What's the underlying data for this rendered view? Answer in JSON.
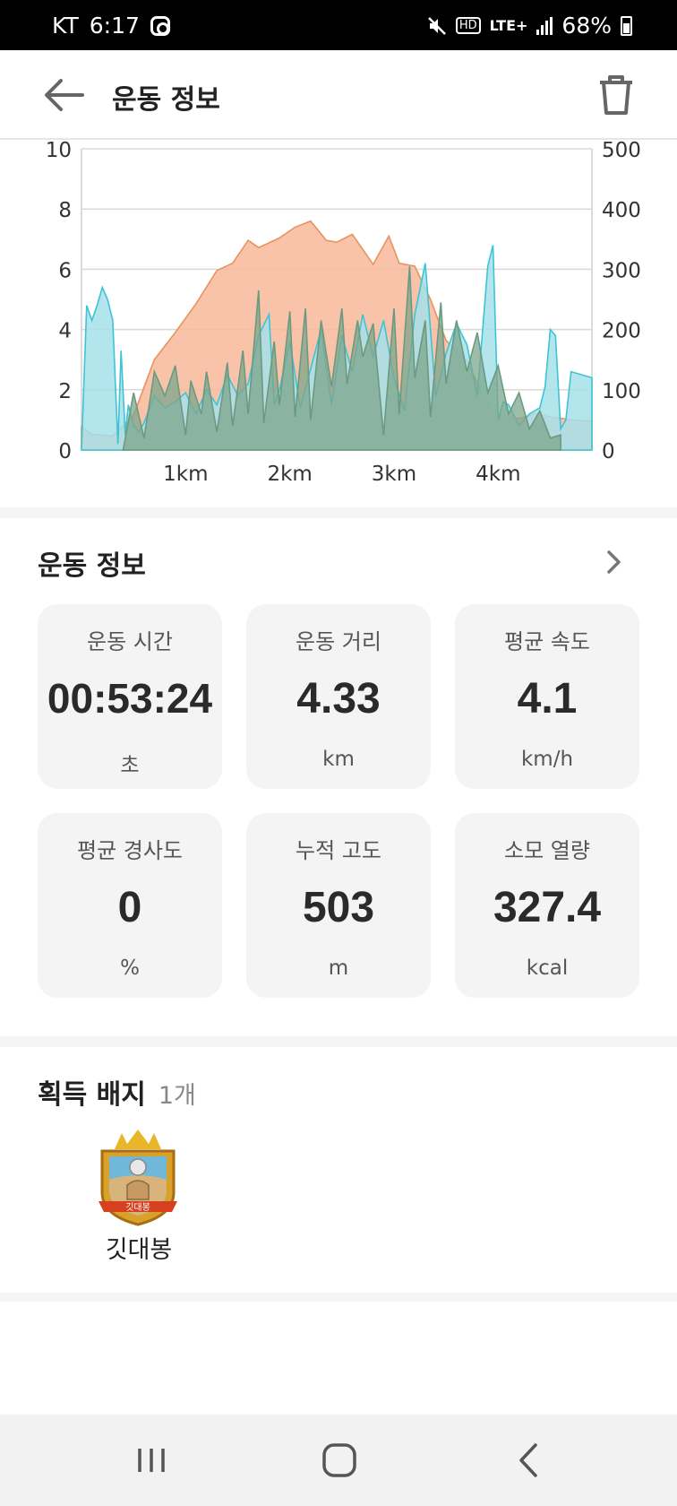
{
  "status_bar": {
    "carrier": "KT",
    "time": "6:17",
    "network": "LTE+",
    "hd": "HD",
    "battery": "68%"
  },
  "header": {
    "title": "운동 정보",
    "back_icon": "arrow-left-icon",
    "delete_icon": "trash-icon"
  },
  "chart_data": {
    "type": "area",
    "x_ticks": [
      "1km",
      "2km",
      "3km",
      "4km"
    ],
    "x_range_km": [
      0,
      4.9
    ],
    "y_left": {
      "ticks": [
        0,
        2,
        4,
        6,
        8,
        10
      ],
      "range": [
        0,
        10
      ]
    },
    "y_right": {
      "ticks": [
        0,
        100,
        200,
        300,
        400,
        500
      ],
      "range": [
        0,
        500
      ]
    },
    "grid": true,
    "series": [
      {
        "axis": "right",
        "color": "#f7b899",
        "line_color": "#e7935f",
        "x": [
          0,
          0.1,
          0.3,
          0.5,
          0.7,
          0.9,
          1.1,
          1.3,
          1.45,
          1.6,
          1.7,
          1.9,
          2.05,
          2.2,
          2.35,
          2.45,
          2.6,
          2.8,
          2.95,
          3.05,
          3.2,
          3.35,
          3.5,
          3.7,
          3.85,
          4.0,
          4.2,
          4.35,
          4.5,
          4.75,
          4.9
        ],
        "y": [
          38,
          26,
          23,
          58,
          150,
          195,
          243,
          298,
          310,
          348,
          336,
          352,
          370,
          380,
          348,
          345,
          358,
          308,
          355,
          310,
          305,
          250,
          182,
          148,
          92,
          58,
          52,
          60,
          55,
          49,
          48
        ]
      },
      {
        "axis": "left",
        "color": "#a6e0ea",
        "line_color": "#3fc3d5",
        "x": [
          0,
          0.05,
          0.1,
          0.15,
          0.2,
          0.25,
          0.3,
          0.35,
          0.38,
          0.42,
          0.45,
          0.5,
          0.55,
          0.6,
          0.7,
          0.8,
          0.9,
          1.0,
          1.1,
          1.2,
          1.3,
          1.4,
          1.5,
          1.6,
          1.7,
          1.8,
          1.85,
          1.9,
          2.0,
          2.1,
          2.2,
          2.3,
          2.4,
          2.5,
          2.6,
          2.7,
          2.8,
          2.9,
          3.0,
          3.1,
          3.2,
          3.3,
          3.4,
          3.5,
          3.6,
          3.7,
          3.8,
          3.9,
          3.95,
          4.0,
          4.05,
          4.1,
          4.2,
          4.3,
          4.4,
          4.45,
          4.5,
          4.55,
          4.6,
          4.65,
          4.7,
          4.8,
          4.9
        ],
        "y": [
          0,
          4.8,
          4.3,
          4.8,
          5.4,
          5.0,
          4.3,
          0.2,
          3.3,
          0.5,
          1.5,
          0.8,
          0.6,
          0.9,
          1.8,
          1.4,
          1.6,
          1.9,
          1.2,
          2.0,
          1.5,
          2.5,
          1.8,
          2.2,
          3.8,
          4.5,
          1.5,
          2.0,
          3.6,
          1.4,
          2.7,
          4.0,
          1.5,
          3.8,
          2.6,
          4.5,
          3.1,
          4.3,
          2.4,
          1.3,
          4.5,
          6.2,
          1.8,
          3.2,
          4.2,
          3.5,
          1.8,
          6.1,
          6.8,
          1.0,
          1.6,
          1.5,
          0.8,
          1.2,
          1.4,
          2.1,
          4.0,
          3.8,
          0.7,
          1.0,
          2.6,
          2.5,
          2.4
        ]
      },
      {
        "axis": "left",
        "color": "#7ea68d",
        "line_color": "#6a9a80",
        "x": [
          0.4,
          0.5,
          0.6,
          0.7,
          0.8,
          0.9,
          1.0,
          1.05,
          1.15,
          1.2,
          1.3,
          1.4,
          1.45,
          1.55,
          1.6,
          1.7,
          1.75,
          1.85,
          1.9,
          2.0,
          2.05,
          2.15,
          2.2,
          2.3,
          2.4,
          2.5,
          2.55,
          2.65,
          2.7,
          2.8,
          2.9,
          3.0,
          3.05,
          3.15,
          3.2,
          3.3,
          3.35,
          3.45,
          3.5,
          3.6,
          3.7,
          3.8,
          3.9,
          4.0,
          4.1,
          4.2,
          4.3,
          4.4,
          4.5,
          4.6
        ],
        "y": [
          0,
          1.9,
          0.4,
          2.6,
          1.8,
          2.8,
          0.5,
          2.3,
          1.2,
          2.6,
          0.6,
          2.9,
          0.8,
          3.3,
          1.2,
          5.3,
          0.9,
          3.6,
          1.5,
          4.6,
          1.1,
          4.7,
          1.0,
          4.3,
          2.1,
          4.7,
          2.2,
          4.3,
          3.1,
          4.2,
          0.5,
          4.7,
          1.2,
          6.1,
          2.4,
          4.3,
          1.1,
          4.9,
          2.2,
          4.3,
          2.6,
          3.9,
          1.9,
          2.8,
          1.2,
          1.9,
          0.7,
          1.3,
          0.4,
          0.5
        ]
      }
    ]
  },
  "workout_section": {
    "title": "운동 정보",
    "chevron_icon": "chevron-right-icon"
  },
  "stats": [
    {
      "label": "운동 시간",
      "value": "00:53:24",
      "unit": "초"
    },
    {
      "label": "운동 거리",
      "value": "4.33",
      "unit": "km"
    },
    {
      "label": "평균 속도",
      "value": "4.1",
      "unit": "km/h"
    },
    {
      "label": "평균 경사도",
      "value": "0",
      "unit": "%"
    },
    {
      "label": "누적 고도",
      "value": "503",
      "unit": "m"
    },
    {
      "label": "소모 열량",
      "value": "327.4",
      "unit": "kcal"
    }
  ],
  "badges_section": {
    "title": "획득 배지",
    "count": "1개",
    "badges": [
      {
        "name": "깃대봉",
        "emblem_text": "깃대봉"
      }
    ]
  },
  "nav_bar": {
    "recents_icon": "recents-icon",
    "home_icon": "home-icon",
    "back_icon": "back-chevron-icon"
  }
}
